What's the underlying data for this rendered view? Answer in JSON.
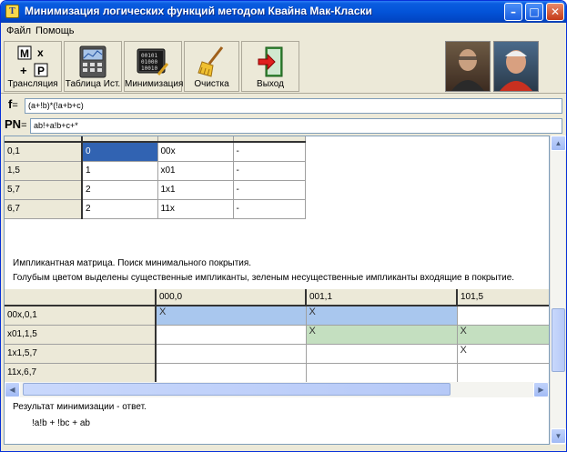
{
  "window": {
    "title": "Минимизация логических функций методом Квайна Мак-Класки",
    "app_icon_letter": "T"
  },
  "menu": [
    "Файл",
    "Помощь"
  ],
  "toolbar": {
    "buttons": [
      {
        "id": "translate",
        "label": "Трансляция"
      },
      {
        "id": "truth-table",
        "label": "Таблица Ист."
      },
      {
        "id": "minimize",
        "label": "Минимизация"
      },
      {
        "id": "clear",
        "label": "Очистка"
      },
      {
        "id": "exit",
        "label": "Выход"
      }
    ],
    "translate_icon_glyphs": [
      "M",
      "x",
      "+",
      "P"
    ],
    "minimize_icon_glyphs": [
      "00101",
      "01000",
      "10010"
    ]
  },
  "formula": {
    "label": "f",
    "eq": "=",
    "value": "(a+!b)*(!a+b+c)"
  },
  "pn": {
    "label": "PN",
    "eq": "=",
    "value": "ab!+a!b+c+*"
  },
  "groups_table": {
    "rows": [
      [
        "0,1",
        "0",
        "00x",
        "-"
      ],
      [
        "1,5",
        "1",
        "x01",
        "-"
      ],
      [
        "5,7",
        "2",
        "1x1",
        "-"
      ],
      [
        "6,7",
        "2",
        "11x",
        "-"
      ]
    ]
  },
  "matrix_title": "Импликантная матрица. Поиск минимального покрытия.",
  "matrix_legend": "Голубым цветом выделены существенные импликанты, зеленым несущественные импликанты входящие в покрытие.",
  "matrix": {
    "columns": [
      "000,0",
      "001,1",
      "101,5"
    ],
    "rows": [
      {
        "label": "00x,0,1",
        "cells": [
          "X",
          "X",
          ""
        ],
        "color": "blue"
      },
      {
        "label": "x01,1,5",
        "cells": [
          "",
          "X",
          "X"
        ],
        "color": "green"
      },
      {
        "label": "1x1,5,7",
        "cells": [
          "",
          "",
          "X"
        ],
        "color": ""
      },
      {
        "label": "11x,6,7",
        "cells": [
          "",
          "",
          ""
        ],
        "color": ""
      }
    ]
  },
  "result": {
    "title": "Результат минимизации - ответ.",
    "value": "!a!b + !bc +  ab"
  }
}
